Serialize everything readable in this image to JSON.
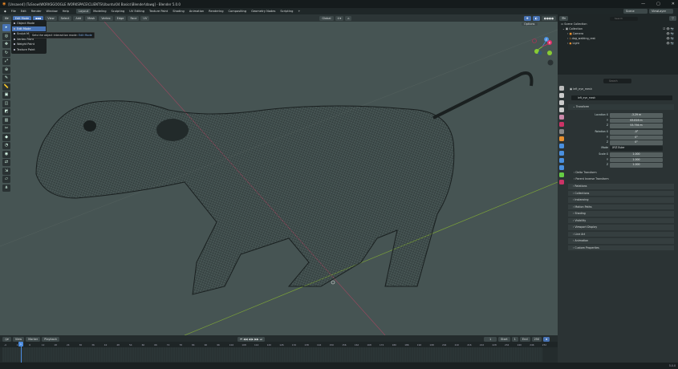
{
  "title_bar": {
    "title": "[Unsaved] (TuSnow\\WORKSGOOGLE WORKSPACE\\CLIENTS\\Ubuntu\\04 Basics\\Blender\\dawg] - Blender 5.0.0",
    "minimize": "—",
    "maximize": "▢",
    "close": "✕"
  },
  "menu": {
    "items": [
      "File",
      "Edit",
      "Render",
      "Window",
      "Help"
    ],
    "workspaces": [
      "Layout",
      "Modeling",
      "Sculpting",
      "UV Editing",
      "Texture Paint",
      "Shading",
      "Animation",
      "Rendering",
      "Compositing",
      "Geometry Nodes",
      "Scripting",
      "+"
    ],
    "active_workspace": "Layout",
    "scene": "Scene",
    "view_layer": "ViewLayer"
  },
  "viewport_header": {
    "mode": "Edit Mode",
    "menus": [
      "View",
      "Select",
      "Add",
      "Mesh",
      "Vertex",
      "Edge",
      "Face",
      "UV"
    ],
    "orientation": "Global",
    "options": "Options"
  },
  "mode_menu": {
    "items": [
      "Object Mode",
      "Edit Mode",
      "Sculpt Mode",
      "Vertex Paint",
      "Weight Paint",
      "Texture Paint"
    ],
    "selected": "Edit Mode"
  },
  "tooltip": {
    "text": "Sets the object interaction mode:",
    "value": "Edit Mode"
  },
  "gizmo": {
    "x": "X",
    "y": "Y",
    "z": "Z"
  },
  "outliner": {
    "search_placeholder": "Search",
    "scene_collection": "Scene Collection",
    "collection": "Collection",
    "objects": [
      "Camera",
      "dog_walking_rest",
      "Light"
    ]
  },
  "properties": {
    "search_placeholder": "Search",
    "object_name": "left_eye_mesh",
    "data_name": "left_eye_mesh",
    "transform_title": "Transform",
    "location": {
      "label": "Location X",
      "x": "-3.29 m",
      "y": "63.816 m",
      "z": "53.794 m"
    },
    "rotation": {
      "label": "Rotation X",
      "x": "-0°",
      "y": "0°",
      "z": "0°"
    },
    "mode": {
      "label": "Mode",
      "value": "XYZ Euler"
    },
    "scale": {
      "label": "Scale X",
      "x": "1.000",
      "y": "1.000",
      "z": "1.000"
    },
    "axis": {
      "y": "Y",
      "z": "Z"
    },
    "subpanels": [
      "Delta Transform",
      "Parent Inverse Transform"
    ],
    "panels": [
      "Relations",
      "Collections",
      "Instancing",
      "Motion Paths",
      "Shading",
      "Visibility",
      "Viewport Display",
      "Line Art",
      "Animation",
      "Custom Properties"
    ]
  },
  "timeline": {
    "menus": [
      "View",
      "Marker",
      "Playback"
    ],
    "current_frame": "1",
    "start_label": "Start",
    "start": "1",
    "end_label": "End",
    "end": "250",
    "ticks": [
      "-4",
      "1",
      "6",
      "12",
      "18",
      "24",
      "30",
      "36",
      "42",
      "48",
      "54",
      "60",
      "66",
      "72",
      "78",
      "84",
      "90",
      "96",
      "102",
      "108",
      "114",
      "120",
      "126",
      "132",
      "138",
      "144",
      "150",
      "156",
      "162",
      "168",
      "174",
      "180",
      "186",
      "192",
      "198",
      "204",
      "210",
      "216",
      "222",
      "228",
      "234",
      "240",
      "246",
      "252"
    ]
  },
  "status": {
    "version": "5.0.0"
  }
}
